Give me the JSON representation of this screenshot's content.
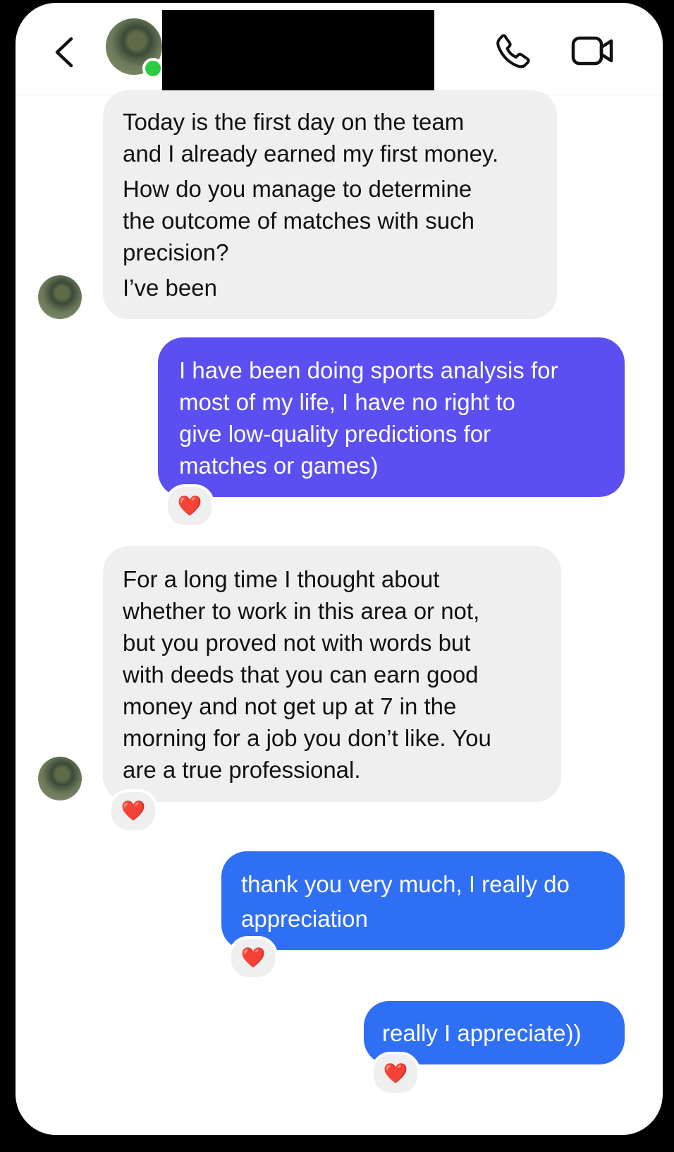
{
  "header": {
    "back_icon": "chevron-left-icon",
    "contact_status": "online",
    "call_icon": "phone-icon",
    "video_icon": "video-camera-icon"
  },
  "messages": [
    {
      "direction": "incoming",
      "lines": [
        "Today is the first day on the team",
        "and I already earned my first money.",
        "How do you manage to determine",
        "the outcome of matches with such",
        "precision?",
        "I’ve been"
      ]
    },
    {
      "direction": "outgoing",
      "color": "#5b4ff1",
      "lines": [
        "I have been doing sports analysis for",
        "most of my life, I have no right to",
        "give low-quality predictions for",
        "matches or games)"
      ],
      "reaction": "❤️"
    },
    {
      "direction": "incoming",
      "lines": [
        "For a long time I thought about",
        "whether to work in this area or not,",
        "but you proved not with words but",
        "with deeds that you can earn good",
        "money and not get up at 7 in the",
        "morning for a job you don’t like. You",
        "are a true professional."
      ],
      "reaction": "❤️"
    },
    {
      "direction": "outgoing",
      "color": "#2f6ff4",
      "lines": [
        "thank you very much, I really do",
        "appreciation"
      ],
      "reaction": "❤️"
    },
    {
      "direction": "outgoing",
      "color": "#2f6ff4",
      "lines": [
        "really I appreciate))"
      ],
      "reaction": "❤️"
    }
  ]
}
